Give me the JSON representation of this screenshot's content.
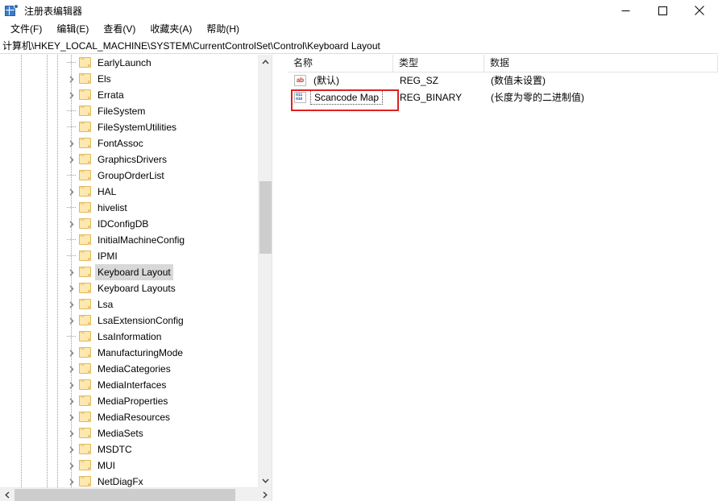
{
  "window": {
    "title": "注册表编辑器",
    "app_icon": "registry-editor-icon",
    "controls": {
      "minimize": "minimize-icon",
      "maximize": "maximize-icon",
      "close": "close-icon"
    }
  },
  "menubar": {
    "items": [
      {
        "label": "文件(F)"
      },
      {
        "label": "编辑(E)"
      },
      {
        "label": "查看(V)"
      },
      {
        "label": "收藏夹(A)"
      },
      {
        "label": "帮助(H)"
      }
    ]
  },
  "address": {
    "path": "计算机\\HKEY_LOCAL_MACHINE\\SYSTEM\\CurrentControlSet\\Control\\Keyboard Layout"
  },
  "tree": {
    "items": [
      {
        "label": "EarlyLaunch",
        "expandable": false,
        "selected": false
      },
      {
        "label": "Els",
        "expandable": true,
        "selected": false
      },
      {
        "label": "Errata",
        "expandable": true,
        "selected": false
      },
      {
        "label": "FileSystem",
        "expandable": false,
        "selected": false
      },
      {
        "label": "FileSystemUtilities",
        "expandable": false,
        "selected": false
      },
      {
        "label": "FontAssoc",
        "expandable": true,
        "selected": false
      },
      {
        "label": "GraphicsDrivers",
        "expandable": true,
        "selected": false
      },
      {
        "label": "GroupOrderList",
        "expandable": false,
        "selected": false
      },
      {
        "label": "HAL",
        "expandable": true,
        "selected": false
      },
      {
        "label": "hivelist",
        "expandable": false,
        "selected": false
      },
      {
        "label": "IDConfigDB",
        "expandable": true,
        "selected": false
      },
      {
        "label": "InitialMachineConfig",
        "expandable": false,
        "selected": false
      },
      {
        "label": "IPMI",
        "expandable": false,
        "selected": false
      },
      {
        "label": "Keyboard Layout",
        "expandable": true,
        "selected": true
      },
      {
        "label": "Keyboard Layouts",
        "expandable": true,
        "selected": false
      },
      {
        "label": "Lsa",
        "expandable": true,
        "selected": false
      },
      {
        "label": "LsaExtensionConfig",
        "expandable": true,
        "selected": false
      },
      {
        "label": "LsaInformation",
        "expandable": false,
        "selected": false
      },
      {
        "label": "ManufacturingMode",
        "expandable": true,
        "selected": false
      },
      {
        "label": "MediaCategories",
        "expandable": true,
        "selected": false
      },
      {
        "label": "MediaInterfaces",
        "expandable": true,
        "selected": false
      },
      {
        "label": "MediaProperties",
        "expandable": true,
        "selected": false
      },
      {
        "label": "MediaResources",
        "expandable": true,
        "selected": false
      },
      {
        "label": "MediaSets",
        "expandable": true,
        "selected": false
      },
      {
        "label": "MSDTC",
        "expandable": true,
        "selected": false
      },
      {
        "label": "MUI",
        "expandable": true,
        "selected": false
      },
      {
        "label": "NetDiagFx",
        "expandable": true,
        "selected": false
      }
    ]
  },
  "list": {
    "columns": [
      {
        "label": "名称"
      },
      {
        "label": "类型"
      },
      {
        "label": "数据"
      }
    ],
    "rows": [
      {
        "icon": "string-value-icon",
        "icon_text": "ab",
        "name": "(默认)",
        "type": "REG_SZ",
        "data": "(数值未设置)",
        "focused": false
      },
      {
        "icon": "binary-value-icon",
        "icon_text": "011010",
        "name": "Scancode Map",
        "type": "REG_BINARY",
        "data": "(长度为零的二进制值)",
        "focused": true
      }
    ]
  },
  "annotation": {
    "highlight_color": "#e02020",
    "target": "Scancode Map"
  },
  "colors": {
    "folder": "#fde9b0",
    "folder_border": "#e0b95b",
    "selection": "#d8d8d8",
    "scrollbar_track": "#f0f0f0",
    "scrollbar_thumb": "#cdcdcd",
    "string_icon_text": "#c0392b",
    "binary_icon_text": "#2b62b5"
  }
}
